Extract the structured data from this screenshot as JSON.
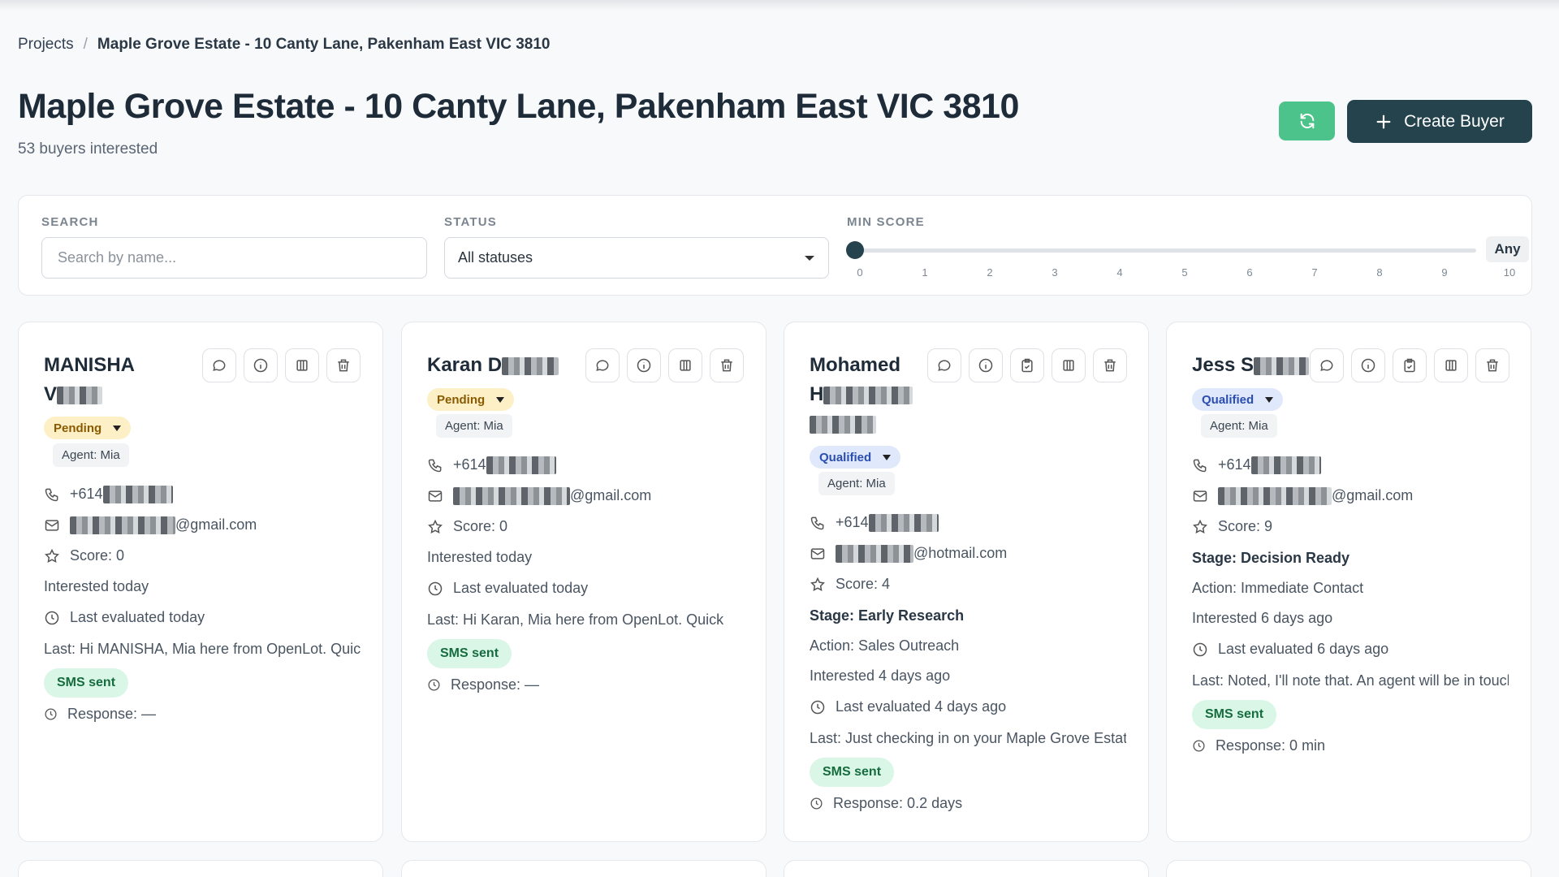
{
  "breadcrumb": {
    "root": "Projects",
    "separator": "/",
    "current": "Maple Grove Estate - 10 Canty Lane, Pakenham East VIC 3810"
  },
  "page": {
    "title": "Maple Grove Estate - 10 Canty Lane, Pakenham East VIC 3810",
    "subtitle": "53 buyers interested"
  },
  "toolbar": {
    "create_label": "Create Buyer",
    "refresh_icon": "refresh-icon",
    "accent": "#4cc38a",
    "primary": "#24434d"
  },
  "filters": {
    "search_label": "SEARCH",
    "search_placeholder": "Search by name...",
    "status_label": "STATUS",
    "status_value": "All statuses",
    "score_label": "MIN SCORE",
    "score_value": 0,
    "score_ticks": [
      "0",
      "1",
      "2",
      "3",
      "4",
      "5",
      "6",
      "7",
      "8",
      "9",
      "10"
    ],
    "score_badge": "Any"
  },
  "buyers": [
    {
      "name_line1": "MANISHA",
      "name_line2": "V",
      "status": "Pending",
      "agent": "Agent: Mia",
      "phone": "+614",
      "email_suffix": "@gmail.com",
      "score": "Score: 0",
      "interested": "Interested today",
      "evaluated": "Last evaluated today",
      "last": "Last: Hi MANISHA, Mia here from OpenLot. Quick",
      "sms": "SMS sent",
      "response": "Response: —"
    },
    {
      "name_line1": "Karan D",
      "status": "Pending",
      "agent": "Agent: Mia",
      "phone": "+614",
      "email_suffix": "@gmail.com",
      "score": "Score: 0",
      "interested": "Interested today",
      "evaluated": "Last evaluated today",
      "last": "Last: Hi Karan, Mia here from OpenLot. Quick",
      "sms": "SMS sent",
      "response": "Response: —"
    },
    {
      "name_line1": "Mohamed",
      "name_line2": "H",
      "status": "Qualified",
      "agent": "Agent: Mia",
      "phone": "+614",
      "email_suffix": "@hotmail.com",
      "score": "Score: 4",
      "stage": "Stage: Early Research",
      "action": "Action: Sales Outreach",
      "interested": "Interested 4 days ago",
      "evaluated": "Last evaluated 4 days ago",
      "last": "Last: Just checking in on your Maple Grove Estate",
      "sms": "SMS sent",
      "response": "Response: 0.2 days"
    },
    {
      "name_line1": "Jess S",
      "status": "Qualified",
      "agent": "Agent: Mia",
      "phone": "+614",
      "email_suffix": "@gmail.com",
      "score": "Score: 9",
      "stage": "Stage: Decision Ready",
      "action": "Action: Immediate Contact",
      "interested": "Interested 6 days ago",
      "evaluated": "Last evaluated 6 days ago",
      "last": "Last: Noted, I'll note that. An agent will be in touch",
      "sms": "SMS sent",
      "response": "Response: 0 min"
    }
  ]
}
